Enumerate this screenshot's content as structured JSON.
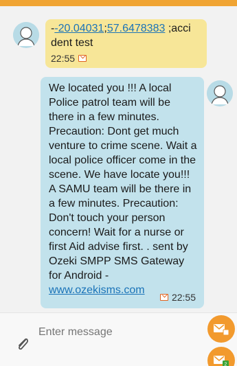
{
  "thread": {
    "incoming": {
      "coord_lat": "-20.04031",
      "coord_lon": "57.6478383",
      "text_after": ";acci dent test",
      "time": "22:55",
      "icon": "message-icon"
    },
    "outgoing": {
      "text": "We located you !!! A local Police patrol team will be there in a few minutes. Precaution: Dont get much venture to crime scene. Wait a local police officer come in the scene. We have locate you!!! A SAMU team will be there in a few minutes. Precaution: Don't touch your person concern! Wait for a nurse or first Aid advise first. . sent by Ozeki SMPP SMS Gateway for Android -",
      "link": "www.ozekisms.com",
      "time": "22:55",
      "icon": "message-icon"
    }
  },
  "composer": {
    "placeholder": "Enter message",
    "attach_icon": "paperclip-icon",
    "send_sim1_icon": "send-sim1-icon",
    "send_sim2_icon": "send-sim2-icon",
    "send_sim2_badge": "2"
  },
  "colors": {
    "accent": "#f0a433",
    "incoming_bubble": "#f7e698",
    "outgoing_bubble": "#c2e2ec",
    "send_button": "#f29a2e"
  }
}
